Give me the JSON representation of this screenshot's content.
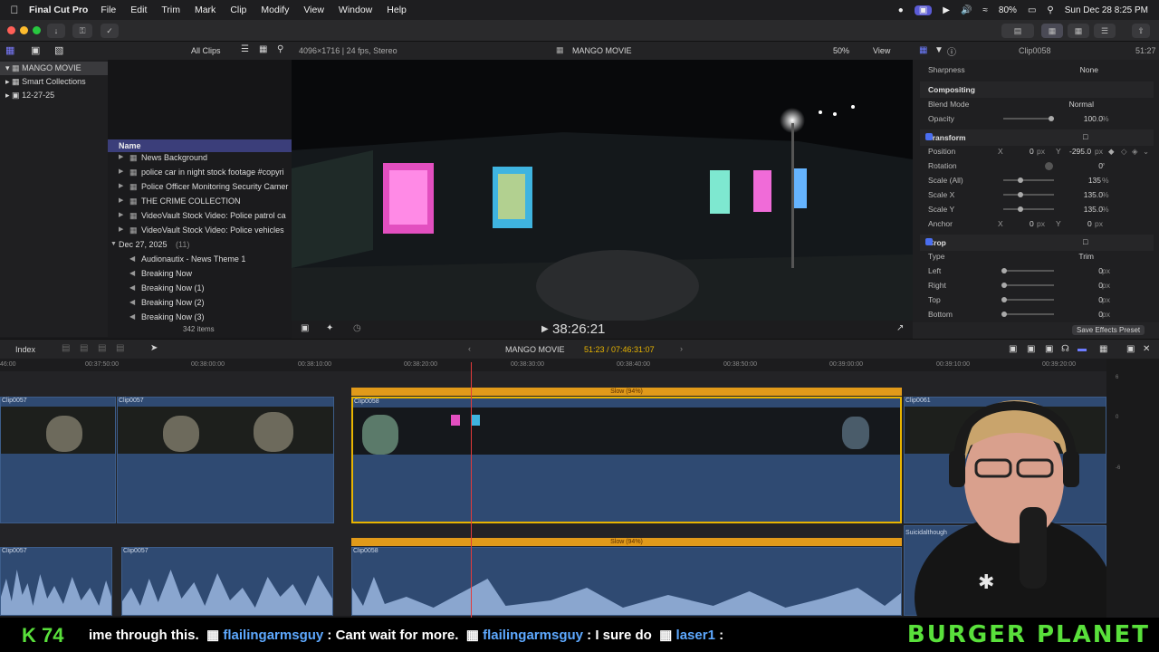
{
  "menubar": {
    "app_name": "Final Cut Pro",
    "menus": [
      "File",
      "Edit",
      "Trim",
      "Mark",
      "Clip",
      "Modify",
      "View",
      "Window",
      "Help"
    ],
    "battery": "80%",
    "datetime": "Sun Dec 28  8:25 PM"
  },
  "browser": {
    "filter_label": "All Clips",
    "library": {
      "name": "MANGO MOVIE",
      "items": [
        "Smart Collections",
        "12-27-25"
      ]
    },
    "column_header": "Name",
    "clips": [
      "News Background",
      "police  car in night stock footage #copyri",
      "Police Officer Monitoring Security Camer",
      "THE CRIME COLLECTION",
      "VideoVault Stock Video:   Police patrol ca",
      "VideoVault Stock Video:   Police vehicles"
    ],
    "event": {
      "date": "Dec 27, 2025",
      "count": "(11)"
    },
    "event_clips": [
      "Audionautix - News Theme 1",
      "Breaking Now",
      "Breaking Now (1)",
      "Breaking Now (2)",
      "Breaking Now (3)"
    ],
    "item_count": "342 items"
  },
  "viewer": {
    "format": "4096×1716 | 24 fps, Stereo",
    "project": "MANGO MOVIE",
    "zoom": "50%",
    "view_label": "View",
    "timecode": "38:26:21"
  },
  "inspector": {
    "clip_name": "Clip0058",
    "duration": "51:27",
    "sharpness": {
      "label": "Sharpness",
      "value": "None"
    },
    "compositing": {
      "title": "Compositing",
      "blend_label": "Blend Mode",
      "blend_value": "Normal",
      "opacity_label": "Opacity",
      "opacity_value": "100.0",
      "opacity_unit": "%"
    },
    "transform": {
      "title": "Transform",
      "position_label": "Position",
      "pos_x_label": "X",
      "pos_x": "0",
      "pos_y_label": "Y",
      "pos_y": "-295.0",
      "px": "px",
      "rotation_label": "Rotation",
      "rotation": "0",
      "deg": "°",
      "scale_all_label": "Scale (All)",
      "scale_all": "135",
      "pct": "%",
      "scale_x_label": "Scale X",
      "scale_x": "135.0",
      "scale_y_label": "Scale Y",
      "scale_y": "135.0",
      "anchor_label": "Anchor",
      "anchor_x": "0",
      "anchor_y": "0"
    },
    "crop": {
      "title": "Crop",
      "type_label": "Type",
      "type_value": "Trim",
      "left_label": "Left",
      "left": "0",
      "right_label": "Right",
      "right": "0",
      "top_label": "Top",
      "top": "0",
      "bottom_label": "Bottom",
      "bottom": "0"
    },
    "save_preset": "Save Effects Preset"
  },
  "timeline": {
    "index_label": "Index",
    "project": "MANGO MOVIE",
    "timecode": "51:23 / 07:46:31:07",
    "ruler": [
      "46:00",
      "00:37:50:00",
      "00:38:00:00",
      "00:38:10:00",
      "00:38:20:00",
      "00:38:30:00",
      "00:38:40:00",
      "00:38:50:00",
      "00:39:00:00",
      "00:39:10:00",
      "00:39:20:00"
    ],
    "clips": [
      "Clip0057",
      "Clip0057",
      "Clip0058",
      "Clip0061"
    ],
    "speed_label": "Slow (94%)",
    "audio_clips": [
      "Clip0057",
      "Clip0057",
      "Clip0058",
      "Suicidalthough"
    ],
    "meter_labels": [
      "6",
      "0",
      "-6"
    ]
  },
  "ticker": {
    "count": "74",
    "lead": "ime through this.",
    "user1": "flailingarmsguy",
    "msg1": " : Cant wait for more.",
    "user2": "flailingarmsguy",
    "msg2": " : I sure do",
    "user3": "laser1",
    "msg3": " :",
    "brand": "BURGER PLANET"
  },
  "colors": {
    "accent": "#4a6ef0",
    "selection": "#e8b400",
    "playhead": "#e23a3a",
    "brand_green": "#59e03b"
  }
}
